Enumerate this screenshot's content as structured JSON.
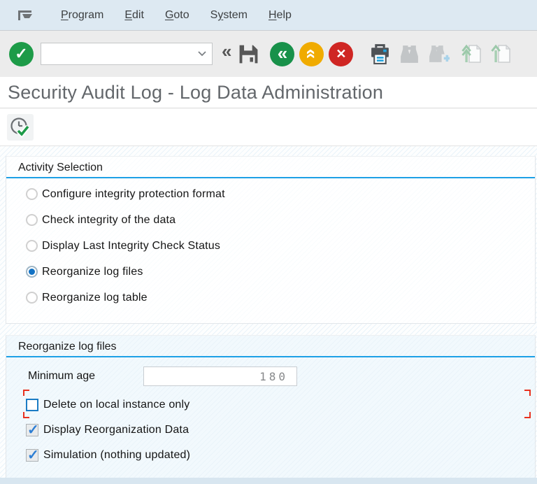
{
  "menubar": {
    "items": [
      {
        "label": "Program",
        "access_key_index": 0
      },
      {
        "label": "Edit",
        "access_key_index": 0
      },
      {
        "label": "Goto",
        "access_key_index": 0
      },
      {
        "label": "System",
        "access_key_index": 1
      },
      {
        "label": "Help",
        "access_key_index": 0
      }
    ]
  },
  "toolbar": {
    "command_field": {
      "value": "",
      "placeholder": ""
    },
    "glyphs": {
      "enter": "✓",
      "collapse": "«",
      "back": "«",
      "exit": "«",
      "cancel": "✕"
    },
    "button_names": [
      "enter",
      "command-field",
      "collapse-command-field",
      "save",
      "back",
      "exit",
      "cancel",
      "print",
      "find",
      "find-next",
      "page-first",
      "page-up"
    ]
  },
  "page_title": "Security Audit Log - Log Data Administration",
  "app_toolbar": {
    "buttons": [
      "execute"
    ]
  },
  "activity_selection": {
    "title": "Activity Selection",
    "options": [
      {
        "label": "Configure integrity protection format",
        "selected": false
      },
      {
        "label": "Check integrity of the data",
        "selected": false
      },
      {
        "label": "Display Last Integrity Check Status",
        "selected": false
      },
      {
        "label": "Reorganize log files",
        "selected": true
      },
      {
        "label": "Reorganize log table",
        "selected": false
      }
    ]
  },
  "reorganize_log_files": {
    "title": "Reorganize log files",
    "fields": [
      {
        "label": "Minimum age",
        "value": "180"
      }
    ],
    "checkboxes": [
      {
        "label": "Delete on local instance only",
        "checked": false,
        "focused": true
      },
      {
        "label": "Display Reorganization Data",
        "checked": true,
        "focused": false
      },
      {
        "label": "Simulation (nothing updated)",
        "checked": true,
        "focused": false
      }
    ]
  },
  "colors": {
    "group_header_underline": "#1da0e6",
    "radio_selected_dot": "#1272c4",
    "focus_corner_red": "#e8311f",
    "enter_green": "#1d9b48",
    "back_green": "#18914a",
    "exit_amber": "#f0ab00",
    "cancel_red": "#cf2623",
    "menubar_bg": "#dde9f2",
    "toolbar_bg": "#ececec",
    "printer_blue": "#23a3dc"
  }
}
